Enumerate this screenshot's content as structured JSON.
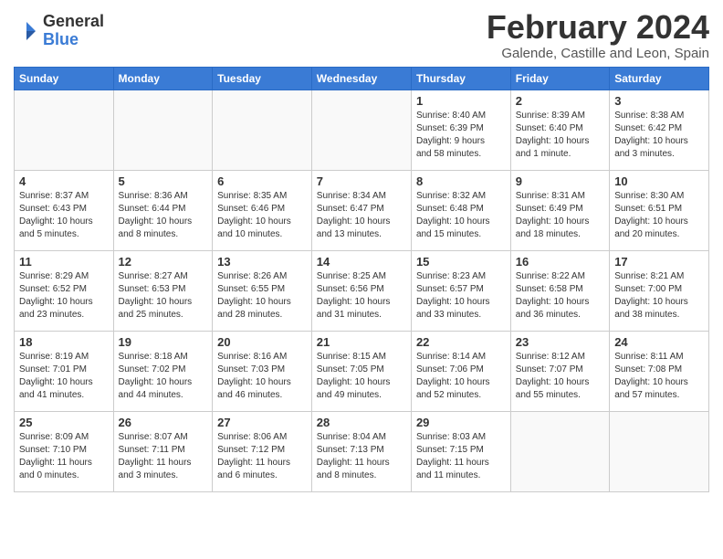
{
  "logo": {
    "general": "General",
    "blue": "Blue"
  },
  "title": {
    "month": "February 2024",
    "location": "Galende, Castille and Leon, Spain"
  },
  "headers": [
    "Sunday",
    "Monday",
    "Tuesday",
    "Wednesday",
    "Thursday",
    "Friday",
    "Saturday"
  ],
  "weeks": [
    [
      {
        "day": "",
        "info": ""
      },
      {
        "day": "",
        "info": ""
      },
      {
        "day": "",
        "info": ""
      },
      {
        "day": "",
        "info": ""
      },
      {
        "day": "1",
        "info": "Sunrise: 8:40 AM\nSunset: 6:39 PM\nDaylight: 9 hours\nand 58 minutes."
      },
      {
        "day": "2",
        "info": "Sunrise: 8:39 AM\nSunset: 6:40 PM\nDaylight: 10 hours\nand 1 minute."
      },
      {
        "day": "3",
        "info": "Sunrise: 8:38 AM\nSunset: 6:42 PM\nDaylight: 10 hours\nand 3 minutes."
      }
    ],
    [
      {
        "day": "4",
        "info": "Sunrise: 8:37 AM\nSunset: 6:43 PM\nDaylight: 10 hours\nand 5 minutes."
      },
      {
        "day": "5",
        "info": "Sunrise: 8:36 AM\nSunset: 6:44 PM\nDaylight: 10 hours\nand 8 minutes."
      },
      {
        "day": "6",
        "info": "Sunrise: 8:35 AM\nSunset: 6:46 PM\nDaylight: 10 hours\nand 10 minutes."
      },
      {
        "day": "7",
        "info": "Sunrise: 8:34 AM\nSunset: 6:47 PM\nDaylight: 10 hours\nand 13 minutes."
      },
      {
        "day": "8",
        "info": "Sunrise: 8:32 AM\nSunset: 6:48 PM\nDaylight: 10 hours\nand 15 minutes."
      },
      {
        "day": "9",
        "info": "Sunrise: 8:31 AM\nSunset: 6:49 PM\nDaylight: 10 hours\nand 18 minutes."
      },
      {
        "day": "10",
        "info": "Sunrise: 8:30 AM\nSunset: 6:51 PM\nDaylight: 10 hours\nand 20 minutes."
      }
    ],
    [
      {
        "day": "11",
        "info": "Sunrise: 8:29 AM\nSunset: 6:52 PM\nDaylight: 10 hours\nand 23 minutes."
      },
      {
        "day": "12",
        "info": "Sunrise: 8:27 AM\nSunset: 6:53 PM\nDaylight: 10 hours\nand 25 minutes."
      },
      {
        "day": "13",
        "info": "Sunrise: 8:26 AM\nSunset: 6:55 PM\nDaylight: 10 hours\nand 28 minutes."
      },
      {
        "day": "14",
        "info": "Sunrise: 8:25 AM\nSunset: 6:56 PM\nDaylight: 10 hours\nand 31 minutes."
      },
      {
        "day": "15",
        "info": "Sunrise: 8:23 AM\nSunset: 6:57 PM\nDaylight: 10 hours\nand 33 minutes."
      },
      {
        "day": "16",
        "info": "Sunrise: 8:22 AM\nSunset: 6:58 PM\nDaylight: 10 hours\nand 36 minutes."
      },
      {
        "day": "17",
        "info": "Sunrise: 8:21 AM\nSunset: 7:00 PM\nDaylight: 10 hours\nand 38 minutes."
      }
    ],
    [
      {
        "day": "18",
        "info": "Sunrise: 8:19 AM\nSunset: 7:01 PM\nDaylight: 10 hours\nand 41 minutes."
      },
      {
        "day": "19",
        "info": "Sunrise: 8:18 AM\nSunset: 7:02 PM\nDaylight: 10 hours\nand 44 minutes."
      },
      {
        "day": "20",
        "info": "Sunrise: 8:16 AM\nSunset: 7:03 PM\nDaylight: 10 hours\nand 46 minutes."
      },
      {
        "day": "21",
        "info": "Sunrise: 8:15 AM\nSunset: 7:05 PM\nDaylight: 10 hours\nand 49 minutes."
      },
      {
        "day": "22",
        "info": "Sunrise: 8:14 AM\nSunset: 7:06 PM\nDaylight: 10 hours\nand 52 minutes."
      },
      {
        "day": "23",
        "info": "Sunrise: 8:12 AM\nSunset: 7:07 PM\nDaylight: 10 hours\nand 55 minutes."
      },
      {
        "day": "24",
        "info": "Sunrise: 8:11 AM\nSunset: 7:08 PM\nDaylight: 10 hours\nand 57 minutes."
      }
    ],
    [
      {
        "day": "25",
        "info": "Sunrise: 8:09 AM\nSunset: 7:10 PM\nDaylight: 11 hours\nand 0 minutes."
      },
      {
        "day": "26",
        "info": "Sunrise: 8:07 AM\nSunset: 7:11 PM\nDaylight: 11 hours\nand 3 minutes."
      },
      {
        "day": "27",
        "info": "Sunrise: 8:06 AM\nSunset: 7:12 PM\nDaylight: 11 hours\nand 6 minutes."
      },
      {
        "day": "28",
        "info": "Sunrise: 8:04 AM\nSunset: 7:13 PM\nDaylight: 11 hours\nand 8 minutes."
      },
      {
        "day": "29",
        "info": "Sunrise: 8:03 AM\nSunset: 7:15 PM\nDaylight: 11 hours\nand 11 minutes."
      },
      {
        "day": "",
        "info": ""
      },
      {
        "day": "",
        "info": ""
      }
    ]
  ]
}
